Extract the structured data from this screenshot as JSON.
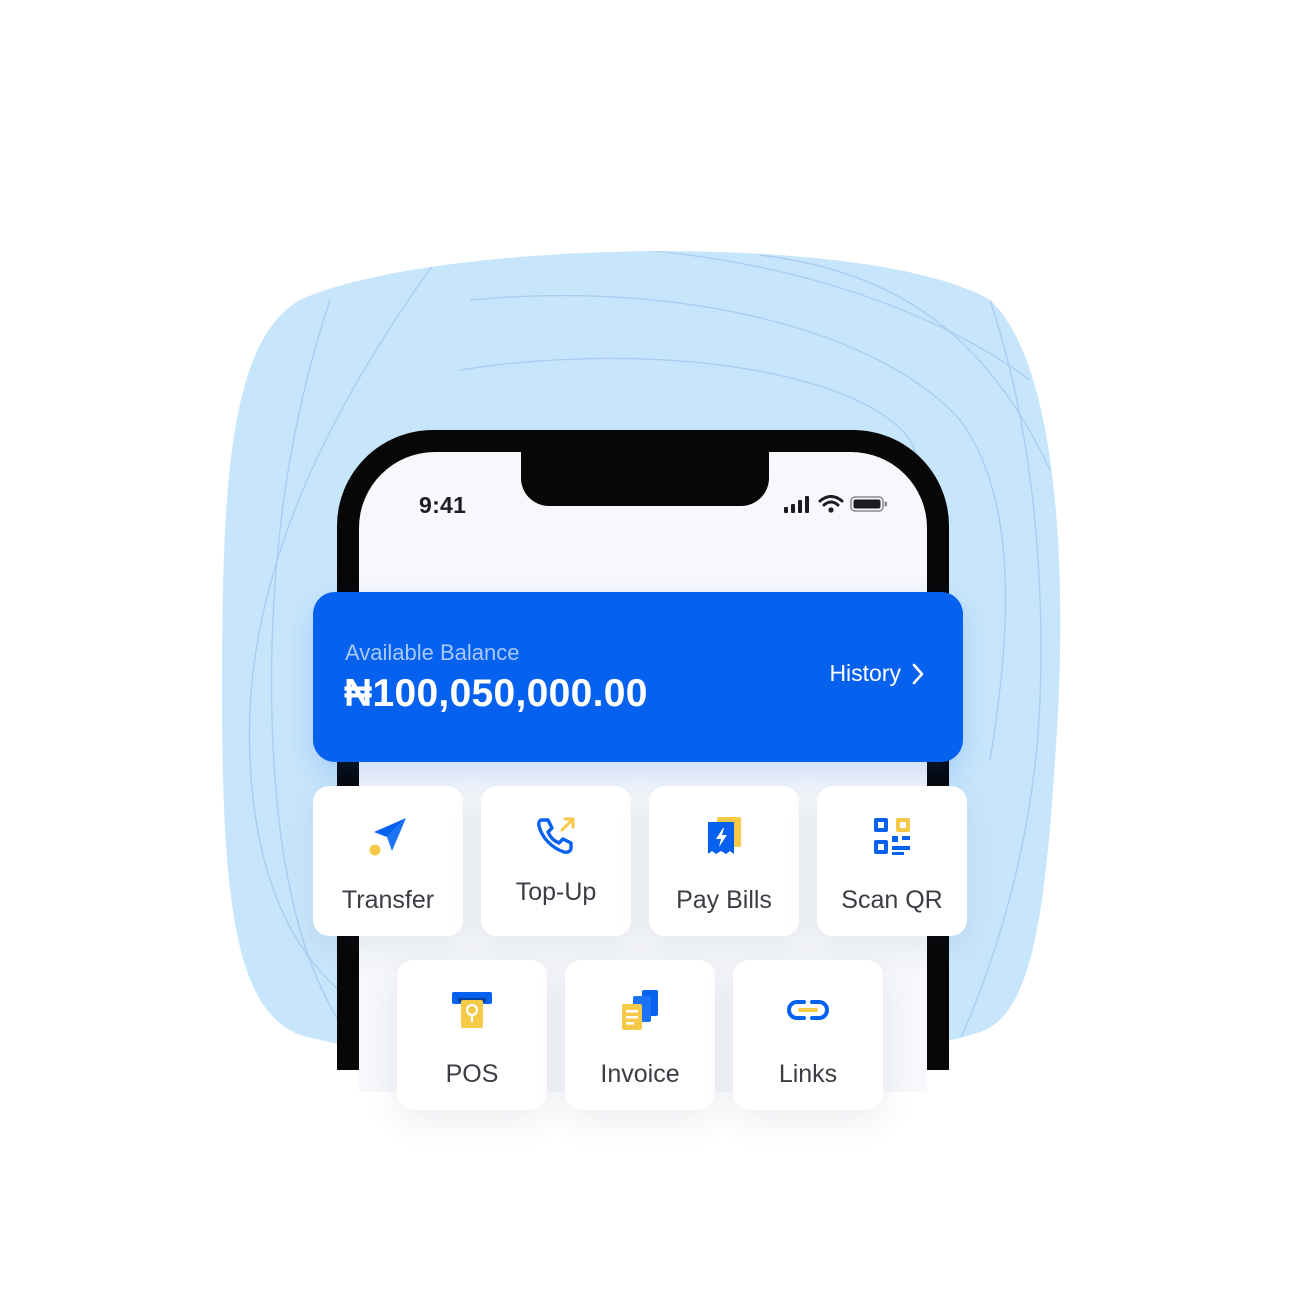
{
  "status_bar": {
    "time": "9:41"
  },
  "balance_card": {
    "label": "Available Balance",
    "amount": "₦100,050,000.00",
    "history_label": "History"
  },
  "actions": [
    {
      "label": "Transfer",
      "icon": "send-icon"
    },
    {
      "label": "Top-Up",
      "icon": "phone-call-icon"
    },
    {
      "label": "Pay Bills",
      "icon": "bill-receipt-icon"
    },
    {
      "label": "Scan QR",
      "icon": "qr-code-icon"
    },
    {
      "label": "POS",
      "icon": "pos-terminal-icon"
    },
    {
      "label": "Invoice",
      "icon": "invoice-icon"
    },
    {
      "label": "Links",
      "icon": "link-icon"
    }
  ],
  "colors": {
    "primary_blue": "#0561ee",
    "accent_yellow": "#f7c948",
    "background_blob": "#c9e6fb"
  }
}
